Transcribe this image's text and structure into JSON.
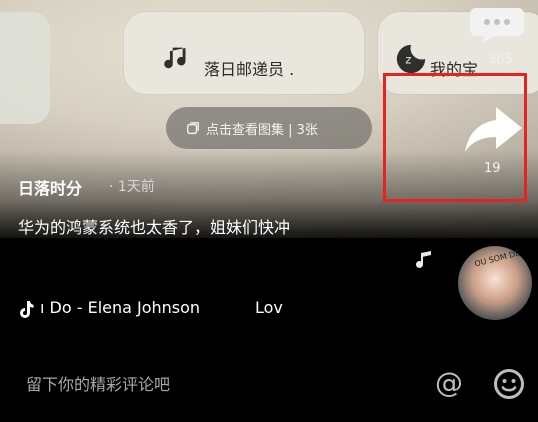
{
  "pills": {
    "music": {
      "label": "落日邮递员 .",
      "icon": "music-note-icon"
    },
    "sleep": {
      "label": "我的宝",
      "icon": "sleep-z-icon"
    }
  },
  "gallery": {
    "label": "点击查看图集 | 3张",
    "icon": "gallery-icon"
  },
  "more_button": {
    "icon": "more-dots-icon",
    "sub": "365"
  },
  "share": {
    "count": "19",
    "icon": "share-arrow-icon"
  },
  "author": {
    "name": "日落时分",
    "time": "· 1天前"
  },
  "caption": {
    "text": "华为的鸿蒙系统也太香了，姐妹们快冲"
  },
  "music_bar": {
    "song": "ı Do - Elena Johnson",
    "song_next": "Lov",
    "icon": "tiktok-note-icon"
  },
  "album": {
    "art_text": "OU SOM DE"
  },
  "comment": {
    "placeholder": "留下你的精彩评论吧",
    "at_icon": "@",
    "emoji_icon": "emoji-icon"
  },
  "colors": {
    "highlight": "#e6231e",
    "bg": "#000000"
  }
}
